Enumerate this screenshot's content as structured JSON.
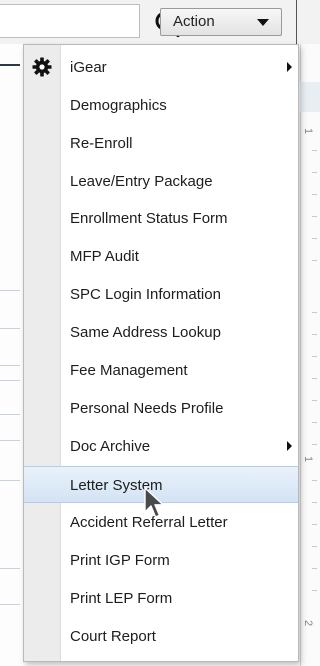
{
  "toolbar": {
    "search_icon": "search-icon",
    "action_label": "Action"
  },
  "menu": {
    "items": [
      {
        "label": "iGear",
        "icon": "gear-icon",
        "has_submenu": true
      },
      {
        "label": "Demographics"
      },
      {
        "label": "Re-Enroll"
      },
      {
        "label": "Leave/Entry Package"
      },
      {
        "label": "Enrollment Status Form"
      },
      {
        "label": "MFP Audit"
      },
      {
        "label": "SPC Login Information"
      },
      {
        "label": "Same Address Lookup"
      },
      {
        "label": "Fee Management"
      },
      {
        "label": "Personal Needs Profile"
      },
      {
        "label": "Doc Archive",
        "has_submenu": true
      },
      {
        "label": "Letter System",
        "highlighted": true
      },
      {
        "label": "Accident Referral Letter"
      },
      {
        "label": "Print IGP Form"
      },
      {
        "label": "Print LEP Form"
      },
      {
        "label": "Court Report"
      }
    ]
  },
  "ruler": {
    "labels": [
      "1",
      "1",
      "2"
    ]
  },
  "colors": {
    "highlight": "#d3e3f4",
    "menu_border": "#b9b9b9"
  }
}
